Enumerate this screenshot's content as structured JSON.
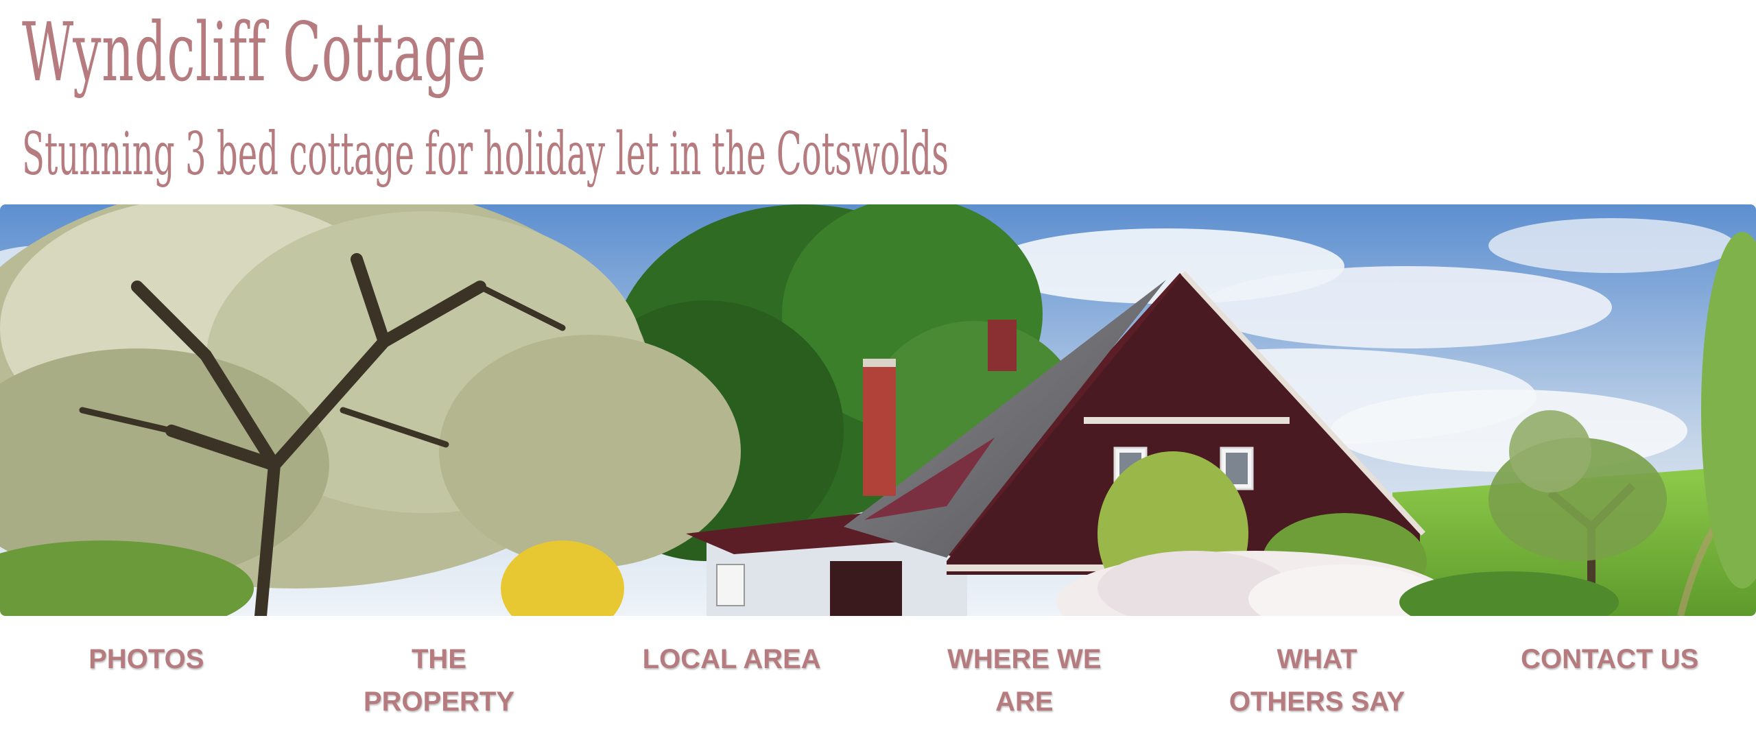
{
  "header": {
    "site_title": "Wyndcliff Cottage",
    "tagline": "Stunning 3 bed cottage for holiday let in the Cotswolds"
  },
  "hero": {
    "icon": "cottage-photo"
  },
  "nav": {
    "items": [
      {
        "label": "PHOTOS"
      },
      {
        "label": "THE PROPERTY"
      },
      {
        "label": "LOCAL AREA"
      },
      {
        "label": "WHERE WE ARE"
      },
      {
        "label": "WHAT OTHERS SAY"
      },
      {
        "label": "CONTACT US"
      }
    ]
  },
  "colors": {
    "accent": "#b57b7f",
    "background": "#ffffff"
  }
}
